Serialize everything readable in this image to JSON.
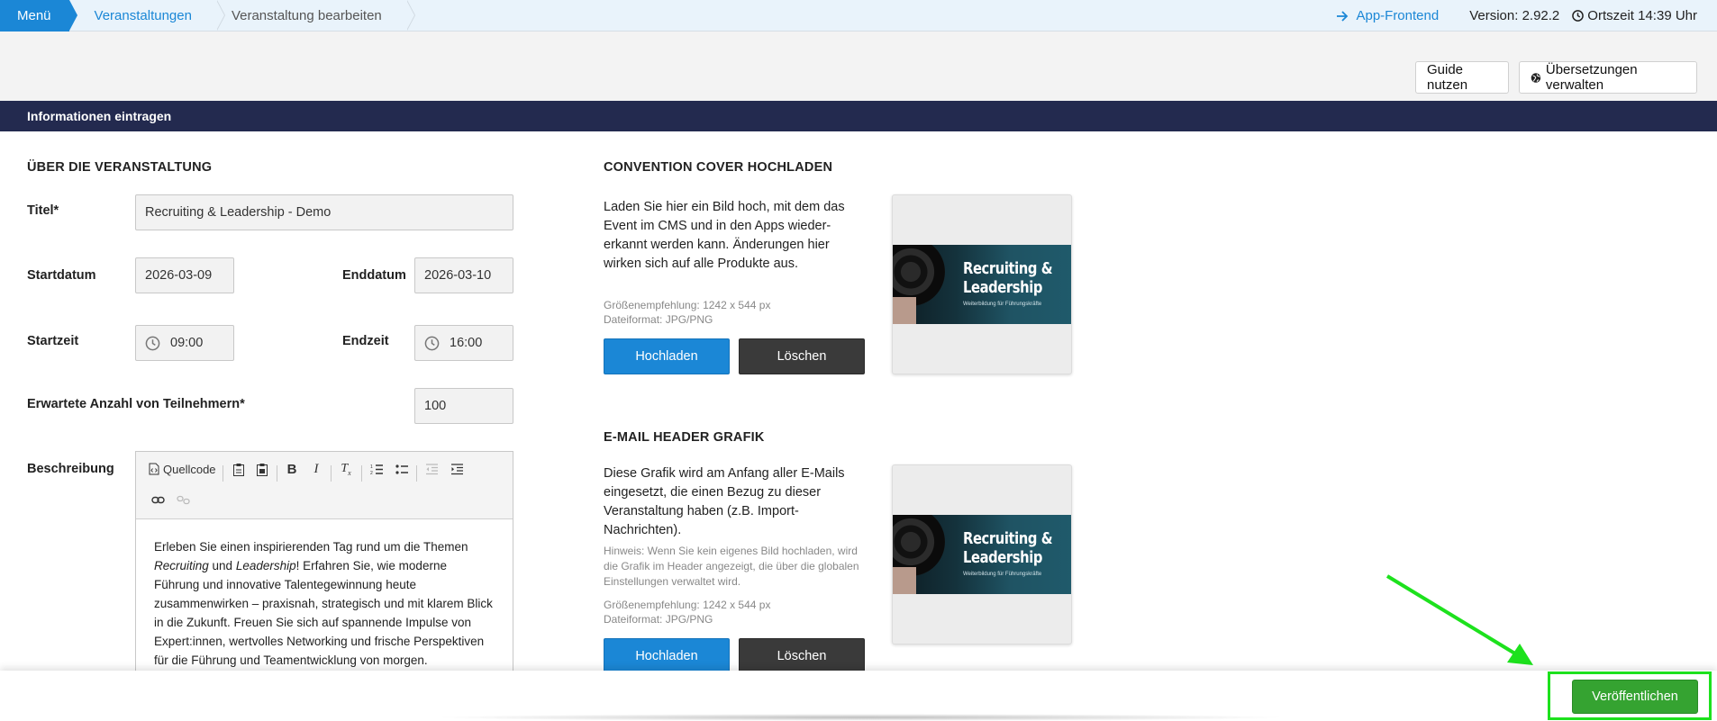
{
  "breadcrumb": {
    "menu": "Menü",
    "items": [
      "Veranstaltungen",
      "Veranstaltung bearbeiten"
    ]
  },
  "topbar": {
    "app_frontend": "App-Frontend",
    "version": "Version: 2.92.2",
    "local_time": "Ortszeit 14:39 Uhr"
  },
  "actions": {
    "guide": "Guide nutzen",
    "translations": "Übersetzungen verwalten"
  },
  "section_title": "Informationen eintragen",
  "event": {
    "heading": "ÜBER DIE VERANSTALTUNG",
    "title_label": "Titel*",
    "title_value": "Recruiting & Leadership - Demo",
    "start_date_label": "Startdatum",
    "start_date": "2026-03-09",
    "end_date_label": "Enddatum",
    "end_date": "2026-03-10",
    "start_time_label": "Startzeit",
    "start_time": "09:00",
    "end_time_label": "Endzeit",
    "end_time": "16:00",
    "attendees_label": "Erwartete Anzahl von Teilnehmern*",
    "attendees": "100",
    "description_label": "Beschreibung"
  },
  "editor": {
    "source_label": "Quellcode",
    "text_1": "Erleben Sie einen inspirierenden Tag rund um die Themen",
    "text_em1": "Recruiting",
    "text_und": " und ",
    "text_em2": "Leadership",
    "text_2": "! Erfahren Sie, wie moderne Führung und innovative Talentegewinnung heute zusammenwirken – praxisnah, strategisch und mit klarem Blick in die Zukunft. Freuen Sie sich auf spannende Impulse von Expert:innen, wertvolles Networking und frische Perspektiven für die Führung und Teamentwicklung von morgen."
  },
  "cover": {
    "heading": "CONVENTION COVER HOCHLADEN",
    "description": "Laden Sie hier ein Bild hoch, mit dem das Event im CMS und in den Apps wieder-erkannt werden kann. Änderungen hier wirken sich auf alle Produkte aus.",
    "size_hint": "Größenempfehlung: 1242 x 544 px",
    "format_hint": "Dateiformat: JPG/PNG",
    "upload": "Hochladen",
    "delete": "Löschen"
  },
  "email_header": {
    "heading": "E-MAIL HEADER GRAFIK",
    "description": "Diese Grafik wird am Anfang aller E-Mails eingesetzt, die einen Bezug zu dieser Veranstaltung haben (z.B. Import-Nachrichten).",
    "notice": "Hinweis: Wenn Sie kein eigenes Bild hochladen, wird die Grafik im Header angezeigt, die über die globalen Einstellungen verwaltet wird.",
    "size_hint": "Größenempfehlung: 1242 x 544 px",
    "format_hint": "Dateiformat: JPG/PNG",
    "upload": "Hochladen",
    "delete": "Löschen"
  },
  "cover_image": {
    "title": "Recruiting & Leadership",
    "subtitle": "Weiterbildung für Führungskräfte"
  },
  "publish": "Veröffentlichen",
  "colors": {
    "accent": "#1b87d6",
    "section_header": "#232a4f",
    "publish": "#35a331",
    "highlight": "#1de11d"
  }
}
